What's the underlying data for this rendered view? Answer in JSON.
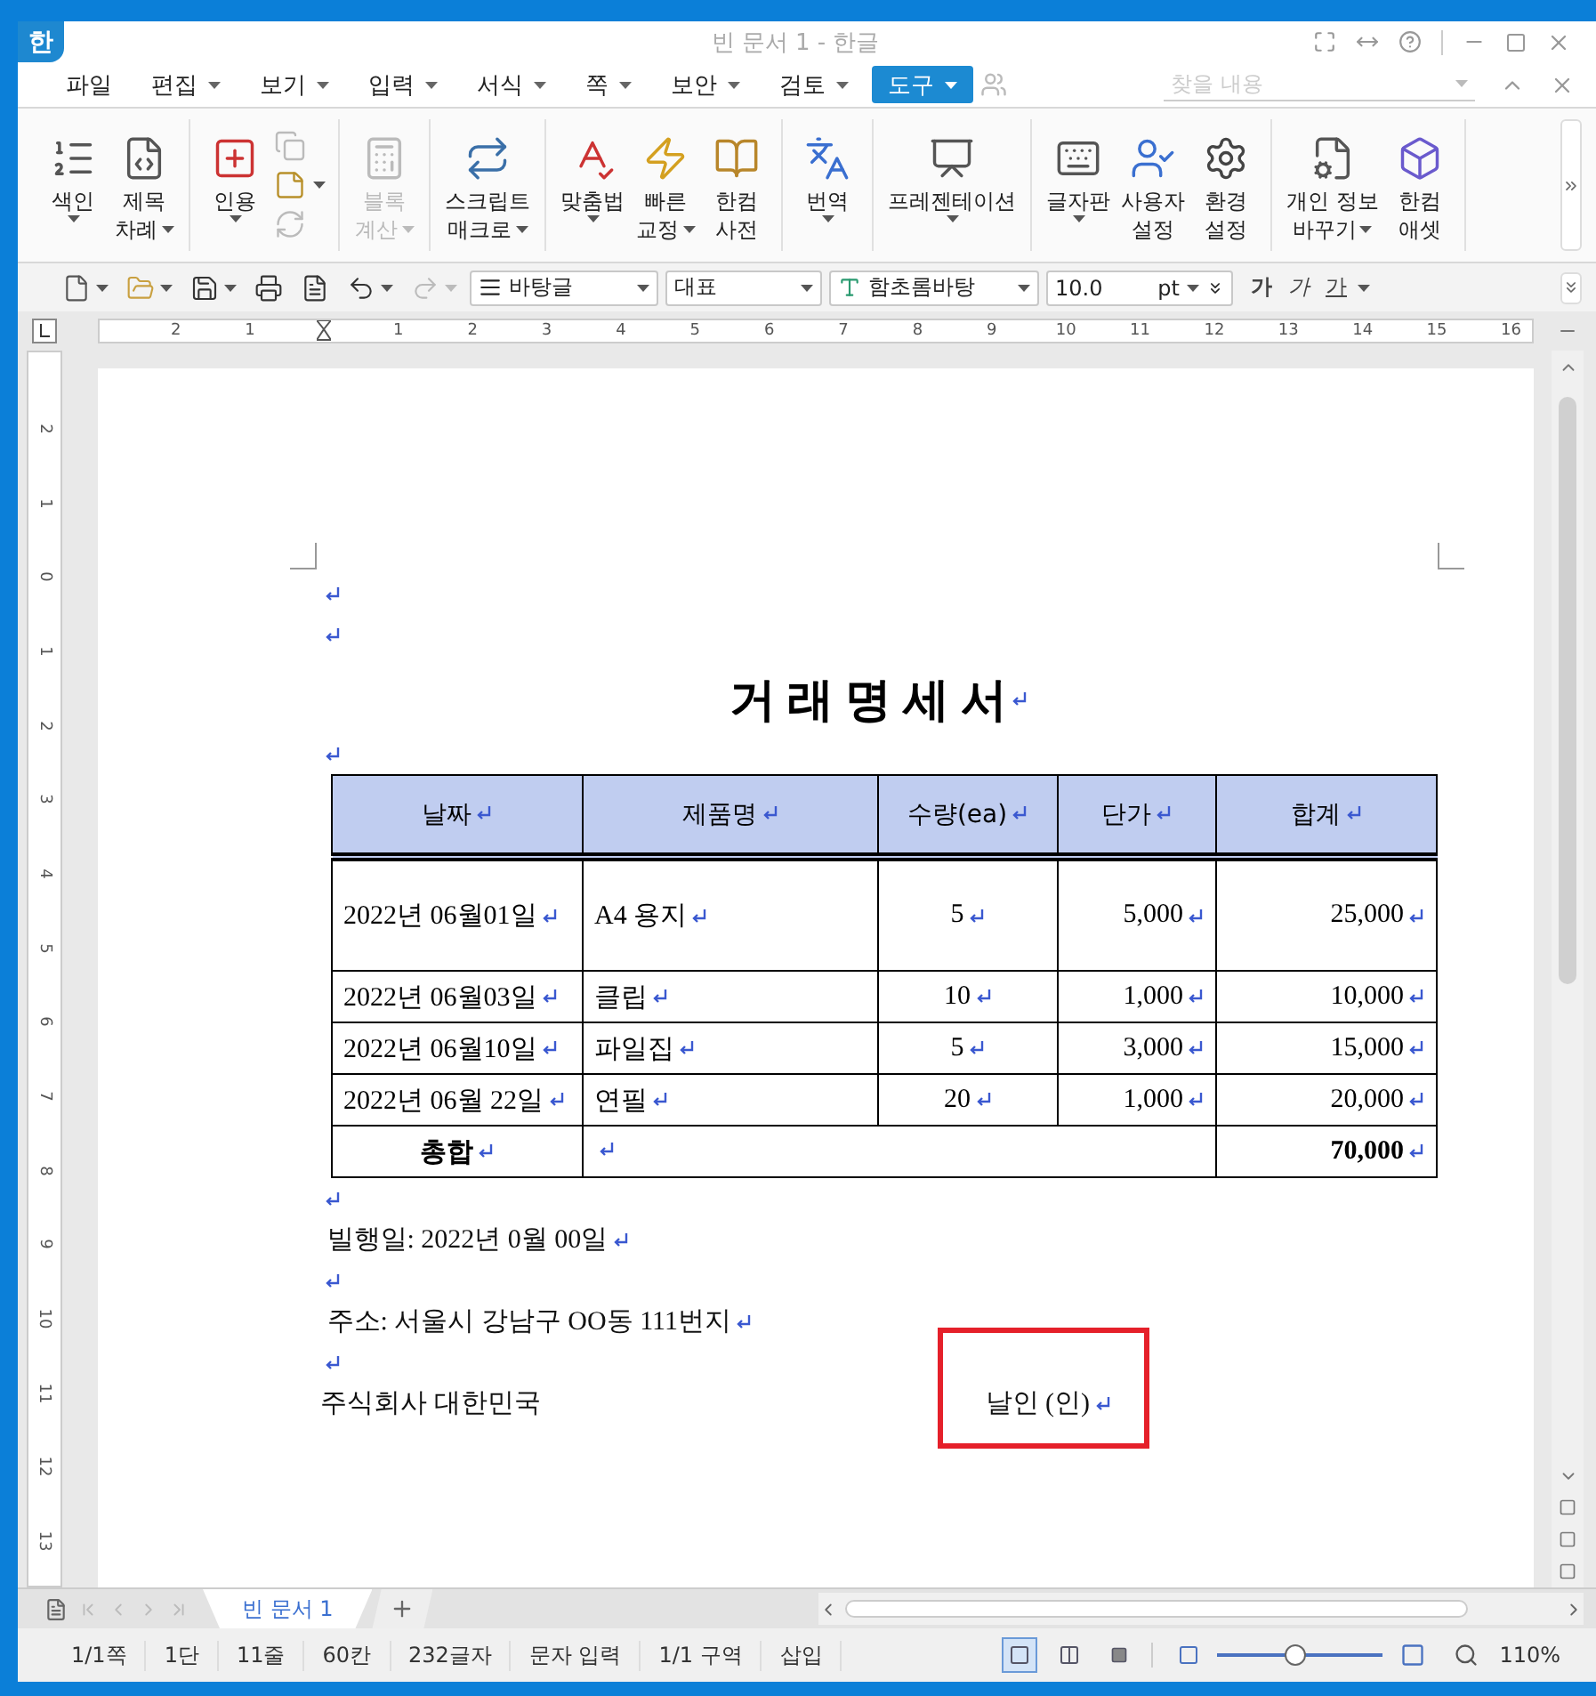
{
  "window": {
    "logo": "한",
    "title": "빈 문서 1 - 한글"
  },
  "menu": [
    {
      "label": "파일",
      "dropdown": false,
      "selected": false
    },
    {
      "label": "편집",
      "dropdown": true,
      "selected": false
    },
    {
      "label": "보기",
      "dropdown": true,
      "selected": false
    },
    {
      "label": "입력",
      "dropdown": true,
      "selected": false
    },
    {
      "label": "서식",
      "dropdown": true,
      "selected": false
    },
    {
      "label": "쪽",
      "dropdown": true,
      "selected": false
    },
    {
      "label": "보안",
      "dropdown": true,
      "selected": false
    },
    {
      "label": "검토",
      "dropdown": true,
      "selected": false
    },
    {
      "label": "도구",
      "dropdown": true,
      "selected": true
    }
  ],
  "search": {
    "placeholder": "찾을 내용"
  },
  "ribbon": [
    {
      "buttons": [
        {
          "kind": "large",
          "lines": [
            "색인"
          ],
          "dropdown": true,
          "disabled": false
        },
        {
          "kind": "large",
          "lines": [
            "제목",
            "차례"
          ],
          "dropdown": true,
          "disabled": false
        }
      ]
    },
    {
      "buttons": [
        {
          "kind": "large",
          "lines": [
            "인용"
          ],
          "dropdown": true,
          "disabled": false
        },
        {
          "kind": "stack",
          "items": [
            {
              "dropdown": false,
              "disabled": true
            },
            {
              "dropdown": true,
              "disabled": false
            },
            {
              "dropdown": false,
              "disabled": true
            }
          ]
        }
      ]
    },
    {
      "buttons": [
        {
          "kind": "large",
          "lines": [
            "블록",
            "계산"
          ],
          "dropdown": true,
          "disabled": true
        }
      ]
    },
    {
      "buttons": [
        {
          "kind": "large",
          "lines": [
            "스크립트",
            "매크로"
          ],
          "dropdown": true,
          "disabled": false
        }
      ]
    },
    {
      "buttons": [
        {
          "kind": "large",
          "lines": [
            "맞춤법"
          ],
          "dropdown": true,
          "disabled": false
        },
        {
          "kind": "large",
          "lines": [
            "빠른",
            "교정"
          ],
          "dropdown": true,
          "disabled": false
        },
        {
          "kind": "large",
          "lines": [
            "한컴",
            "사전"
          ],
          "dropdown": false,
          "disabled": false
        }
      ]
    },
    {
      "buttons": [
        {
          "kind": "large",
          "lines": [
            "번역"
          ],
          "dropdown": true,
          "disabled": false
        }
      ]
    },
    {
      "buttons": [
        {
          "kind": "large",
          "lines": [
            "프레젠테이션"
          ],
          "dropdown": true,
          "disabled": false
        }
      ]
    },
    {
      "buttons": [
        {
          "kind": "large",
          "lines": [
            "글자판"
          ],
          "dropdown": true,
          "disabled": false
        },
        {
          "kind": "large",
          "lines": [
            "사용자",
            "설정"
          ],
          "dropdown": false,
          "disabled": false
        },
        {
          "kind": "large",
          "lines": [
            "환경",
            "설정"
          ],
          "dropdown": false,
          "disabled": false
        }
      ]
    },
    {
      "buttons": [
        {
          "kind": "large",
          "lines": [
            "개인 정보",
            "바꾸기"
          ],
          "dropdown": true,
          "disabled": false
        },
        {
          "kind": "large",
          "lines": [
            "한컴",
            "애셋"
          ],
          "dropdown": false,
          "disabled": false
        }
      ]
    }
  ],
  "format_bar": {
    "tools": [
      {
        "dropdown": true,
        "disabled": false
      },
      {
        "dropdown": true,
        "disabled": false
      },
      {
        "dropdown": true,
        "disabled": false
      },
      {
        "dropdown": false,
        "disabled": false
      },
      {
        "dropdown": false,
        "disabled": false
      },
      {
        "dropdown": true,
        "disabled": false
      },
      {
        "dropdown": true,
        "disabled": true
      }
    ],
    "style": "바탕글",
    "outline": "대표",
    "font": "함초롬바탕",
    "size": "10.0",
    "unit": "pt",
    "char_buttons": [
      {
        "label": "가",
        "kind": "bold"
      },
      {
        "label": "가",
        "kind": "italic"
      },
      {
        "label": "가",
        "kind": "underline"
      }
    ]
  },
  "ruler": {
    "labels": [
      "2",
      "1",
      "1",
      "2",
      "3",
      "4",
      "5",
      "6",
      "7",
      "8",
      "9",
      "10",
      "11",
      "12",
      "13",
      "14",
      "15",
      "16"
    ]
  },
  "vertical_ruler": {
    "labels": [
      "2",
      "1",
      "0",
      "1",
      "2",
      "3",
      "4",
      "5",
      "6",
      "7",
      "8",
      "9",
      "10",
      "11",
      "12",
      "13"
    ]
  },
  "document": {
    "blocks": [
      {
        "kind": "blank"
      },
      {
        "kind": "blank"
      },
      {
        "kind": "title",
        "text": "거 래 명 세 서"
      },
      {
        "kind": "blank"
      },
      {
        "kind": "table"
      },
      {
        "kind": "blank"
      },
      {
        "kind": "text",
        "text": "빌행일: 2022년 0월 00일"
      },
      {
        "kind": "blank"
      },
      {
        "kind": "text",
        "text": "주소: 서울시 강남구 OO동 111번지"
      },
      {
        "kind": "blank"
      },
      {
        "kind": "signature",
        "text": "주식회사 대한민국",
        "seal": "날인 (인)",
        "highlighted": true
      }
    ],
    "table": {
      "columns": [
        {
          "label": "날짜"
        },
        {
          "label": "제품명"
        },
        {
          "label": "수량(ea)"
        },
        {
          "label": "단가"
        },
        {
          "label": "합계"
        }
      ],
      "rows": [
        {
          "tall": true,
          "cells": [
            "2022년 06월01일",
            "A4 용지",
            "5",
            "5,000",
            "25,000"
          ]
        },
        {
          "tall": false,
          "cells": [
            "2022년 06월03일",
            "클립",
            "10",
            "1,000",
            "10,000"
          ]
        },
        {
          "tall": false,
          "cells": [
            "2022년 06월10일",
            "파일집",
            "5",
            "3,000",
            "15,000"
          ]
        },
        {
          "tall": false,
          "cells": [
            "2022년 06월 22일",
            "연필",
            "20",
            "1,000",
            "20,000"
          ]
        }
      ],
      "total": {
        "label": "총합",
        "amount": "70,000"
      }
    }
  },
  "doc_tabs": [
    {
      "label": "빈 문서 1",
      "selected": true
    }
  ],
  "status_bar": {
    "items": [
      "1/1쪽",
      "1단",
      "11줄",
      "60칸",
      "232글자",
      "문자 입력",
      "1/1 구역",
      "삽입"
    ],
    "views": [
      {
        "selected": true
      },
      {
        "selected": false
      },
      {
        "selected": false
      }
    ],
    "zoom": {
      "level": 0.48,
      "reading": "110%"
    }
  }
}
